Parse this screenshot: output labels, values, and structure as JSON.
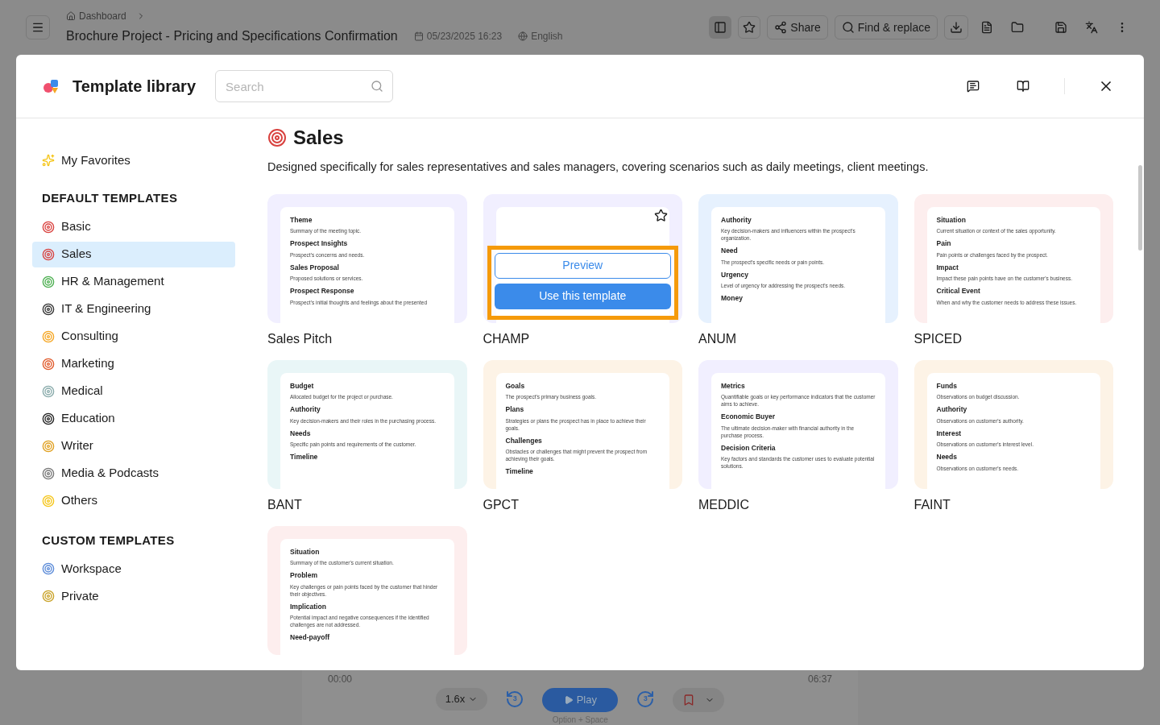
{
  "app_header": {
    "breadcrumb": "Dashboard",
    "title": "Brochure Project - Pricing and Specifications Confirmation",
    "date": "05/23/2025 16:23",
    "language": "English",
    "share": "Share",
    "find_replace": "Find & replace"
  },
  "modal": {
    "title": "Template library",
    "search": {
      "placeholder": "Search"
    }
  },
  "sidebar": {
    "favorites": "My Favorites",
    "sections": [
      {
        "heading": "DEFAULT TEMPLATES",
        "items": [
          {
            "label": "Basic",
            "selected": false
          },
          {
            "label": "Sales",
            "selected": true
          },
          {
            "label": "HR & Management",
            "selected": false
          },
          {
            "label": "IT & Engineering",
            "selected": false
          },
          {
            "label": "Consulting",
            "selected": false
          },
          {
            "label": "Marketing",
            "selected": false
          },
          {
            "label": "Medical",
            "selected": false
          },
          {
            "label": "Education",
            "selected": false
          },
          {
            "label": "Writer",
            "selected": false
          },
          {
            "label": "Media & Podcasts",
            "selected": false
          },
          {
            "label": "Others",
            "selected": false
          }
        ]
      },
      {
        "heading": "CUSTOM TEMPLATES",
        "items": [
          {
            "label": "Workspace",
            "selected": false
          },
          {
            "label": "Private",
            "selected": false
          }
        ]
      }
    ]
  },
  "category": {
    "title": "Sales",
    "description": "Designed specifically for sales representatives and sales managers, covering scenarios such as daily meetings, client meetings."
  },
  "templates": [
    {
      "name": "Sales Pitch",
      "color": "#f1efff",
      "hovered": false,
      "sections": [
        {
          "heading": "Theme",
          "text": "Summary of the meeting topic."
        },
        {
          "heading": "Prospect Insights",
          "text": "Prospect's concerns and needs."
        },
        {
          "heading": "Sales Proposal",
          "text": "Proposed solutions or services."
        },
        {
          "heading": "Prospect Response",
          "text": "Prospect's initial thoughts and feelings about the presented"
        }
      ]
    },
    {
      "name": "CHAMP",
      "color": "#f1efff",
      "hovered": true,
      "preview": "Preview",
      "use": "Use this template"
    },
    {
      "name": "ANUM",
      "color": "#e6f1fe",
      "hovered": false,
      "sections": [
        {
          "heading": "Authority",
          "text": "Key decision-makers and influencers within the prospect's organization."
        },
        {
          "heading": "Need",
          "text": "The prospect's specific needs or pain points."
        },
        {
          "heading": "Urgency",
          "text": "Level of urgency for addressing the prospect's needs."
        },
        {
          "heading": "Money"
        }
      ]
    },
    {
      "name": "SPICED",
      "color": "#fdeeee",
      "hovered": false,
      "sections": [
        {
          "heading": "Situation",
          "text": "Current situation or context of the sales opportunity."
        },
        {
          "heading": "Pain",
          "text": "Pain points or challenges faced by the prospect."
        },
        {
          "heading": "Impact",
          "text": "Impact these pain points have on the customer's business."
        },
        {
          "heading": "Critical Event",
          "text": "When and why the customer needs to address these issues."
        }
      ]
    },
    {
      "name": "BANT",
      "color": "#e9f6f7",
      "hovered": false,
      "sections": [
        {
          "heading": "Budget",
          "text": "Allocated budget for the project or purchase."
        },
        {
          "heading": "Authority",
          "text": "Key decision-makers and their roles in the purchasing process."
        },
        {
          "heading": "Needs",
          "text": "Specific pain points and requirements of the customer."
        },
        {
          "heading": "Timeline"
        }
      ]
    },
    {
      "name": "GPCT",
      "color": "#fdf3e6",
      "hovered": false,
      "sections": [
        {
          "heading": "Goals",
          "text": "The prospect's primary business goals."
        },
        {
          "heading": "Plans",
          "text": "Strategies or plans the prospect has in place to achieve their goals."
        },
        {
          "heading": "Challenges",
          "text": "Obstacles or challenges that might prevent the prospect from achieving their goals."
        },
        {
          "heading": "Timeline"
        }
      ]
    },
    {
      "name": "MEDDIC",
      "color": "#f1efff",
      "hovered": false,
      "sections": [
        {
          "heading": "Metrics",
          "text": "Quantifiable goals or key performance indicators that the customer aims to achieve."
        },
        {
          "heading": "Economic Buyer",
          "text": "The ultimate decision-maker with financial authority in the purchase process."
        },
        {
          "heading": "Decision Criteria",
          "text": "Key factors and standards the customer uses to evaluate potential solutions."
        }
      ]
    },
    {
      "name": "FAINT",
      "color": "#fdf3e6",
      "hovered": false,
      "sections": [
        {
          "heading": "Funds",
          "text": "Observations on budget discussion."
        },
        {
          "heading": "Authority",
          "text": "Observations on customer's authority."
        },
        {
          "heading": "Interest",
          "text": "Observations on customer's interest level."
        },
        {
          "heading": "Needs",
          "text": "Observations on customer's needs."
        }
      ]
    },
    {
      "color": "#fdeeee",
      "hovered": false,
      "sections": [
        {
          "heading": "Situation",
          "text": "Summary of the customer's current situation."
        },
        {
          "heading": "Problem",
          "text": "Key challenges or pain points faced by the customer that hinder their objectives."
        },
        {
          "heading": "Implication",
          "text": "Potential impact and negative consequences if the identified challenges are not addressed."
        },
        {
          "heading": "Need-payoff"
        }
      ]
    }
  ],
  "player": {
    "elapsed": "00:00",
    "duration": "06:37",
    "speed": "1.6x",
    "skip_back": "3",
    "play": "Play",
    "skip_forward": "3",
    "shortcut": "Option + Space"
  }
}
